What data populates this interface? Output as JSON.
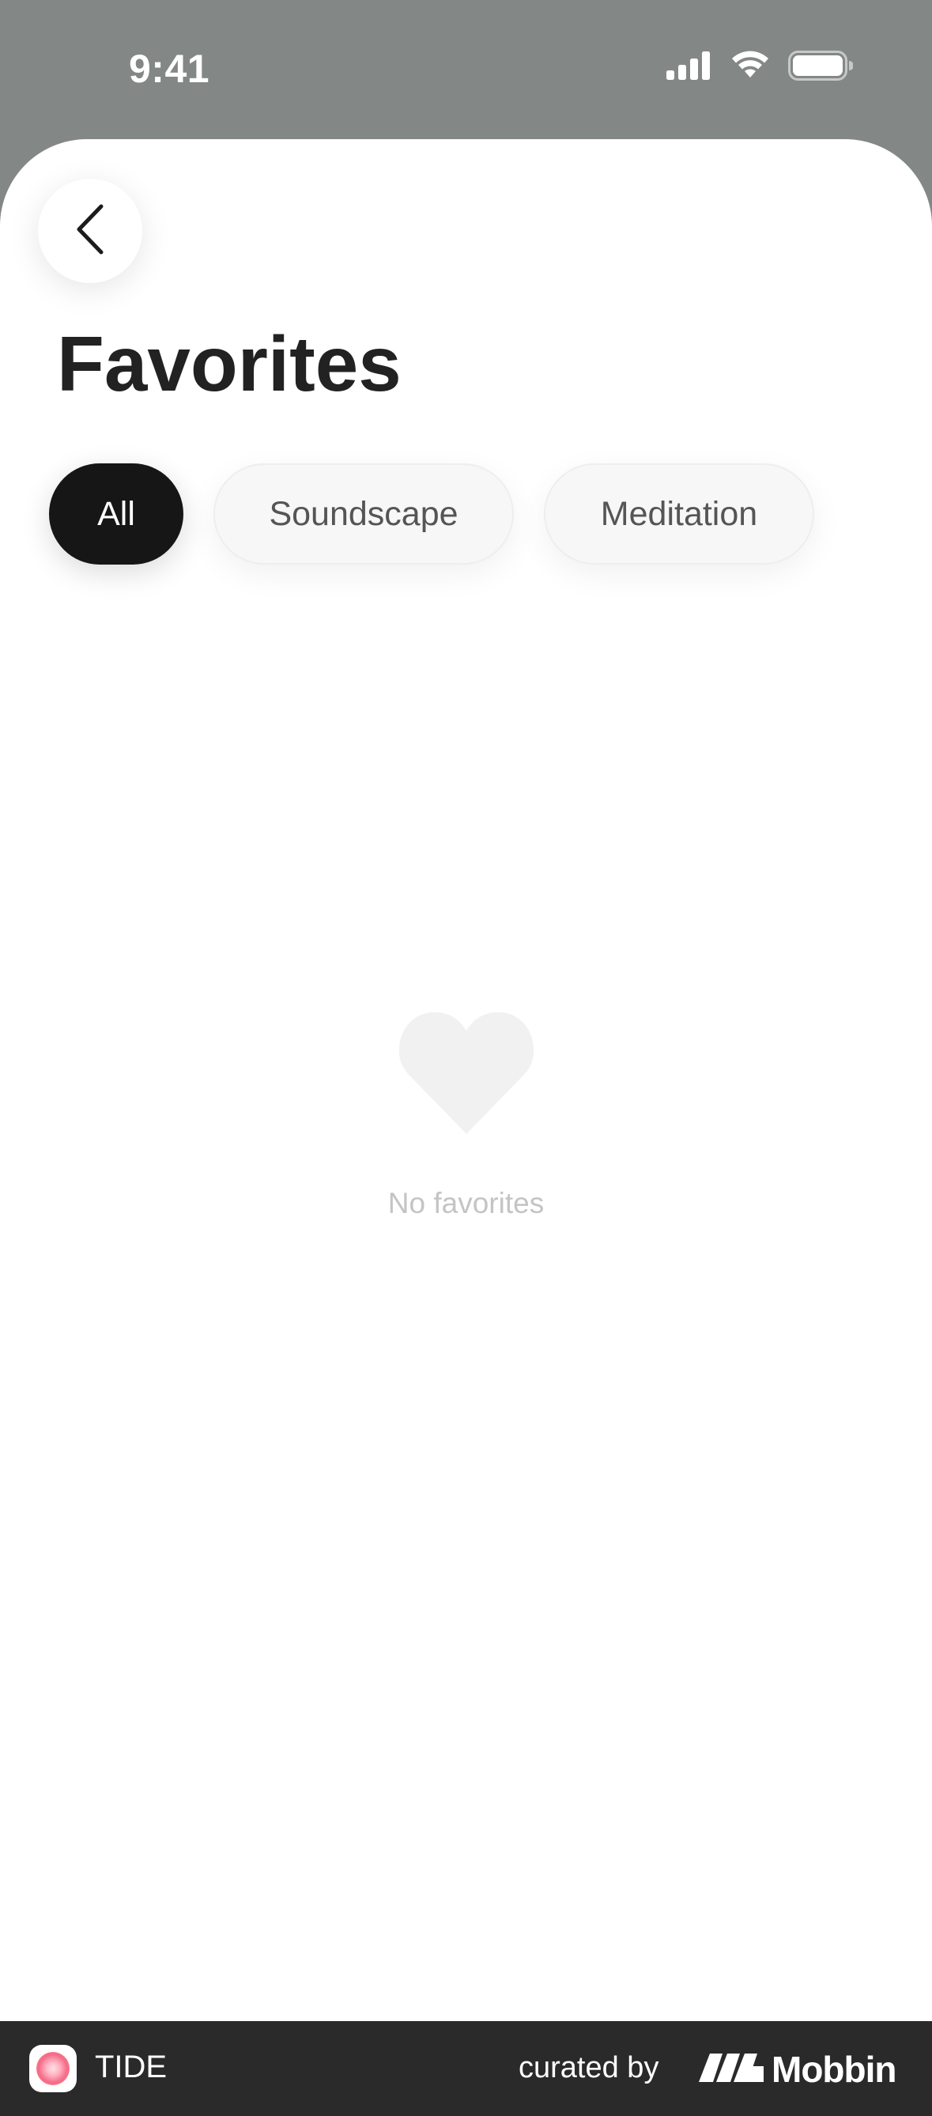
{
  "status_bar": {
    "time": "9:41",
    "icons": [
      "cellular-signal-icon",
      "wifi-icon",
      "battery-icon"
    ]
  },
  "header": {
    "back_icon": "chevron-left-icon",
    "title": "Favorites"
  },
  "filters": {
    "selected": "All",
    "items": [
      {
        "label": "All",
        "active": true
      },
      {
        "label": "Soundscape",
        "active": false
      },
      {
        "label": "Meditation",
        "active": false
      }
    ]
  },
  "empty_state": {
    "icon": "heart-icon",
    "message": "No favorites"
  },
  "brand_bar": {
    "app_name": "TIDE",
    "curated_label": "curated by",
    "curator_name": "Mobbin"
  },
  "colors": {
    "background_top": "#838886",
    "sheet": "#ffffff",
    "chip_active": "#161616",
    "chip_inactive": "#f7f7f7",
    "empty_heart": "#f1f1f1",
    "empty_text": "#c4c4c4",
    "brand_bar": "#2a2a2a"
  }
}
